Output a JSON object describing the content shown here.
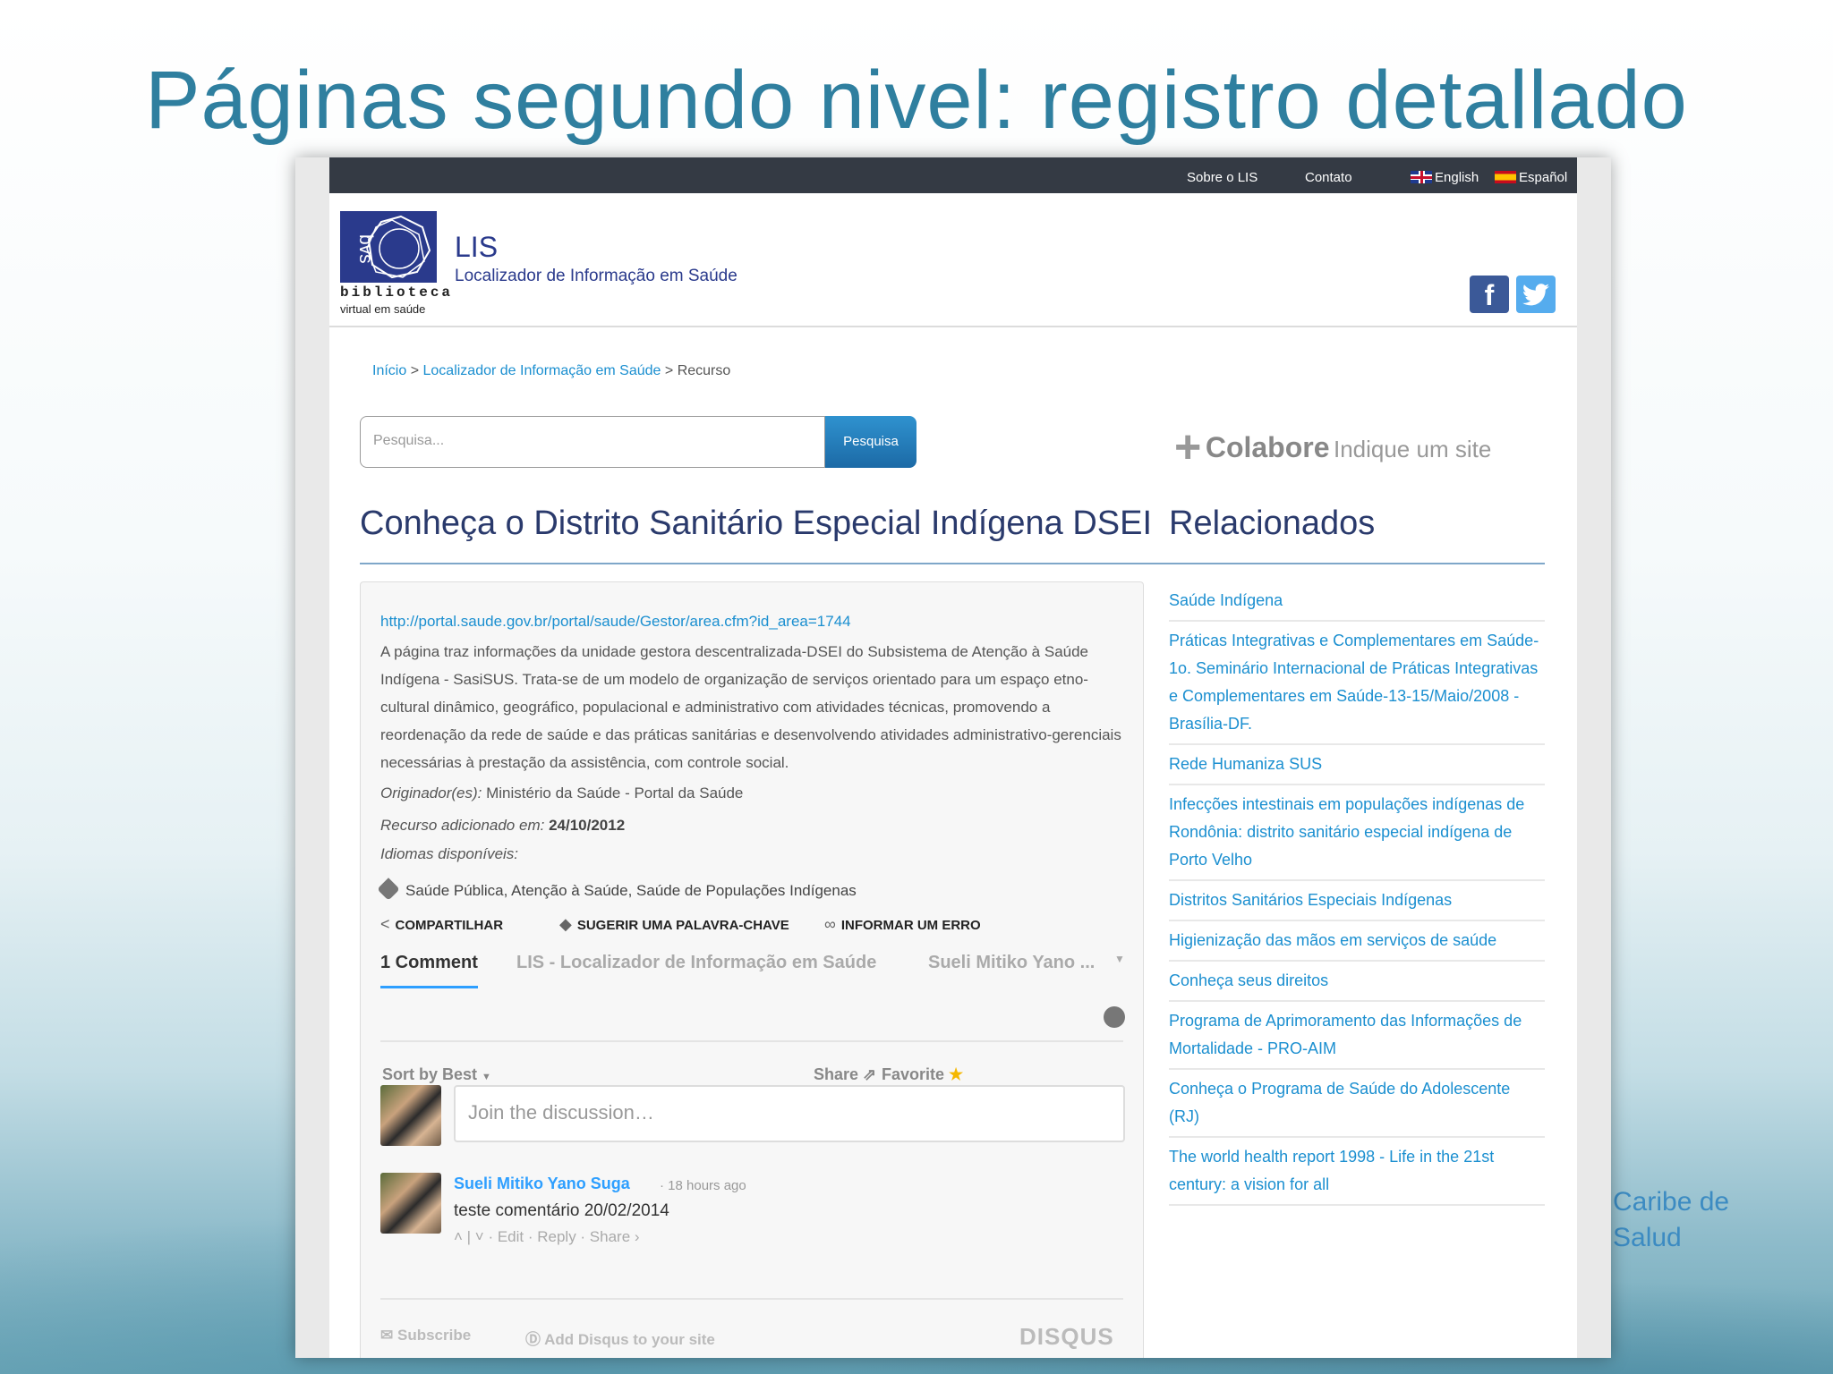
{
  "slide": {
    "title": "Páginas segundo nivel: registro detallado",
    "side_text_line1": "Caribe de",
    "side_text_line2": "Salud"
  },
  "topbar": {
    "about": "Sobre o LIS",
    "contact": "Contato",
    "lang_en": "English",
    "lang_es": "Español"
  },
  "header": {
    "logo_bvs": "bvs",
    "logo_word": "biblioteca",
    "logo_sub": "virtual em saúde",
    "title": "LIS",
    "subtitle": "Localizador de Informação em Saúde",
    "facebook": "f",
    "twitter": "t"
  },
  "breadcrumb": {
    "home": "Início",
    "section": "Localizador de Informação em Saúde",
    "current": "Recurso",
    "sep": ">"
  },
  "search": {
    "placeholder": "Pesquisa...",
    "button": "Pesquisa"
  },
  "colabore": {
    "big": "Colabore",
    "small": "Indique um site"
  },
  "resource": {
    "title": "Conheça o Distrito Sanitário Especial Indígena DSEI",
    "url": "http://portal.saude.gov.br/portal/saude/Gestor/area.cfm?id_area=1744",
    "description": "A página traz informações da unidade gestora descentralizada-DSEI do Subsistema de Atenção à Saúde Indígena - SasiSUS. Trata-se de um modelo de organização de serviços orientado para um espaço etno-cultural dinâmico, geográfico, populacional e administrativo com atividades técnicas, promovendo a reordenação da rede de saúde e das práticas sanitárias e desenvolvendo atividades administrativo-gerenciais necessárias à prestação da assistência, com controle social.",
    "originator_label": "Originador(es):",
    "originator_value": "Ministério da Saúde - Portal da Saúde",
    "added_label": "Recurso adicionado em:",
    "added_value": "24/10/2012",
    "languages_label": "Idiomas disponíveis:",
    "tags": "Saúde Pública, Atenção à Saúde, Saúde de Populações Indígenas",
    "action_share": "COMPARTILHAR",
    "action_keyword": "SUGERIR UMA PALAVRA-CHAVE",
    "action_error": "INFORMAR UM ERRO"
  },
  "disqus": {
    "tab_comments": "1 Comment",
    "tab_site": "LIS - Localizador de Informação em Saúde",
    "tab_user": "Sueli Mitiko Yano ...",
    "sort": "Sort by Best",
    "share": "Share",
    "favorite": "Favorite",
    "join_placeholder": "Join the discussion…",
    "comment_author": "Sueli Mitiko Yano Suga",
    "comment_time": "· 18 hours ago",
    "comment_text": "teste comentário 20/02/2014",
    "comment_actions": "˄ | ˅ · Edit · Reply · Share ›",
    "subscribe": "Subscribe",
    "add_disqus": "Add Disqus to your site",
    "logo": "DISQUS"
  },
  "related": {
    "title": "Relacionados",
    "items": [
      "Saúde Indígena",
      "Práticas Integrativas e Complementares em Saúde-1o. Seminário Internacional de Práticas Integrativas e Complementares em Saúde-13-15/Maio/2008 - Brasília-DF.",
      "Rede Humaniza SUS",
      "Infecções intestinais em populações indígenas de Rondônia: distrito sanitário especial indígena de Porto Velho",
      "Distritos Sanitários Especiais Indígenas",
      "Higienização das mãos em serviços de saúde",
      "Conheça seus direitos",
      "Programa de Aprimoramento das Informações de Mortalidade - PRO-AIM",
      "Conheça o Programa de Saúde do Adolescente (RJ)",
      "The world health report 1998 - Life in the 21st century: a vision for all"
    ]
  },
  "colors": {
    "title": "#2f7f9f",
    "link": "#1b8fd0",
    "brand": "#2a3a8c",
    "topbar": "#343a44",
    "disqus_accent": "#2e9fff"
  }
}
